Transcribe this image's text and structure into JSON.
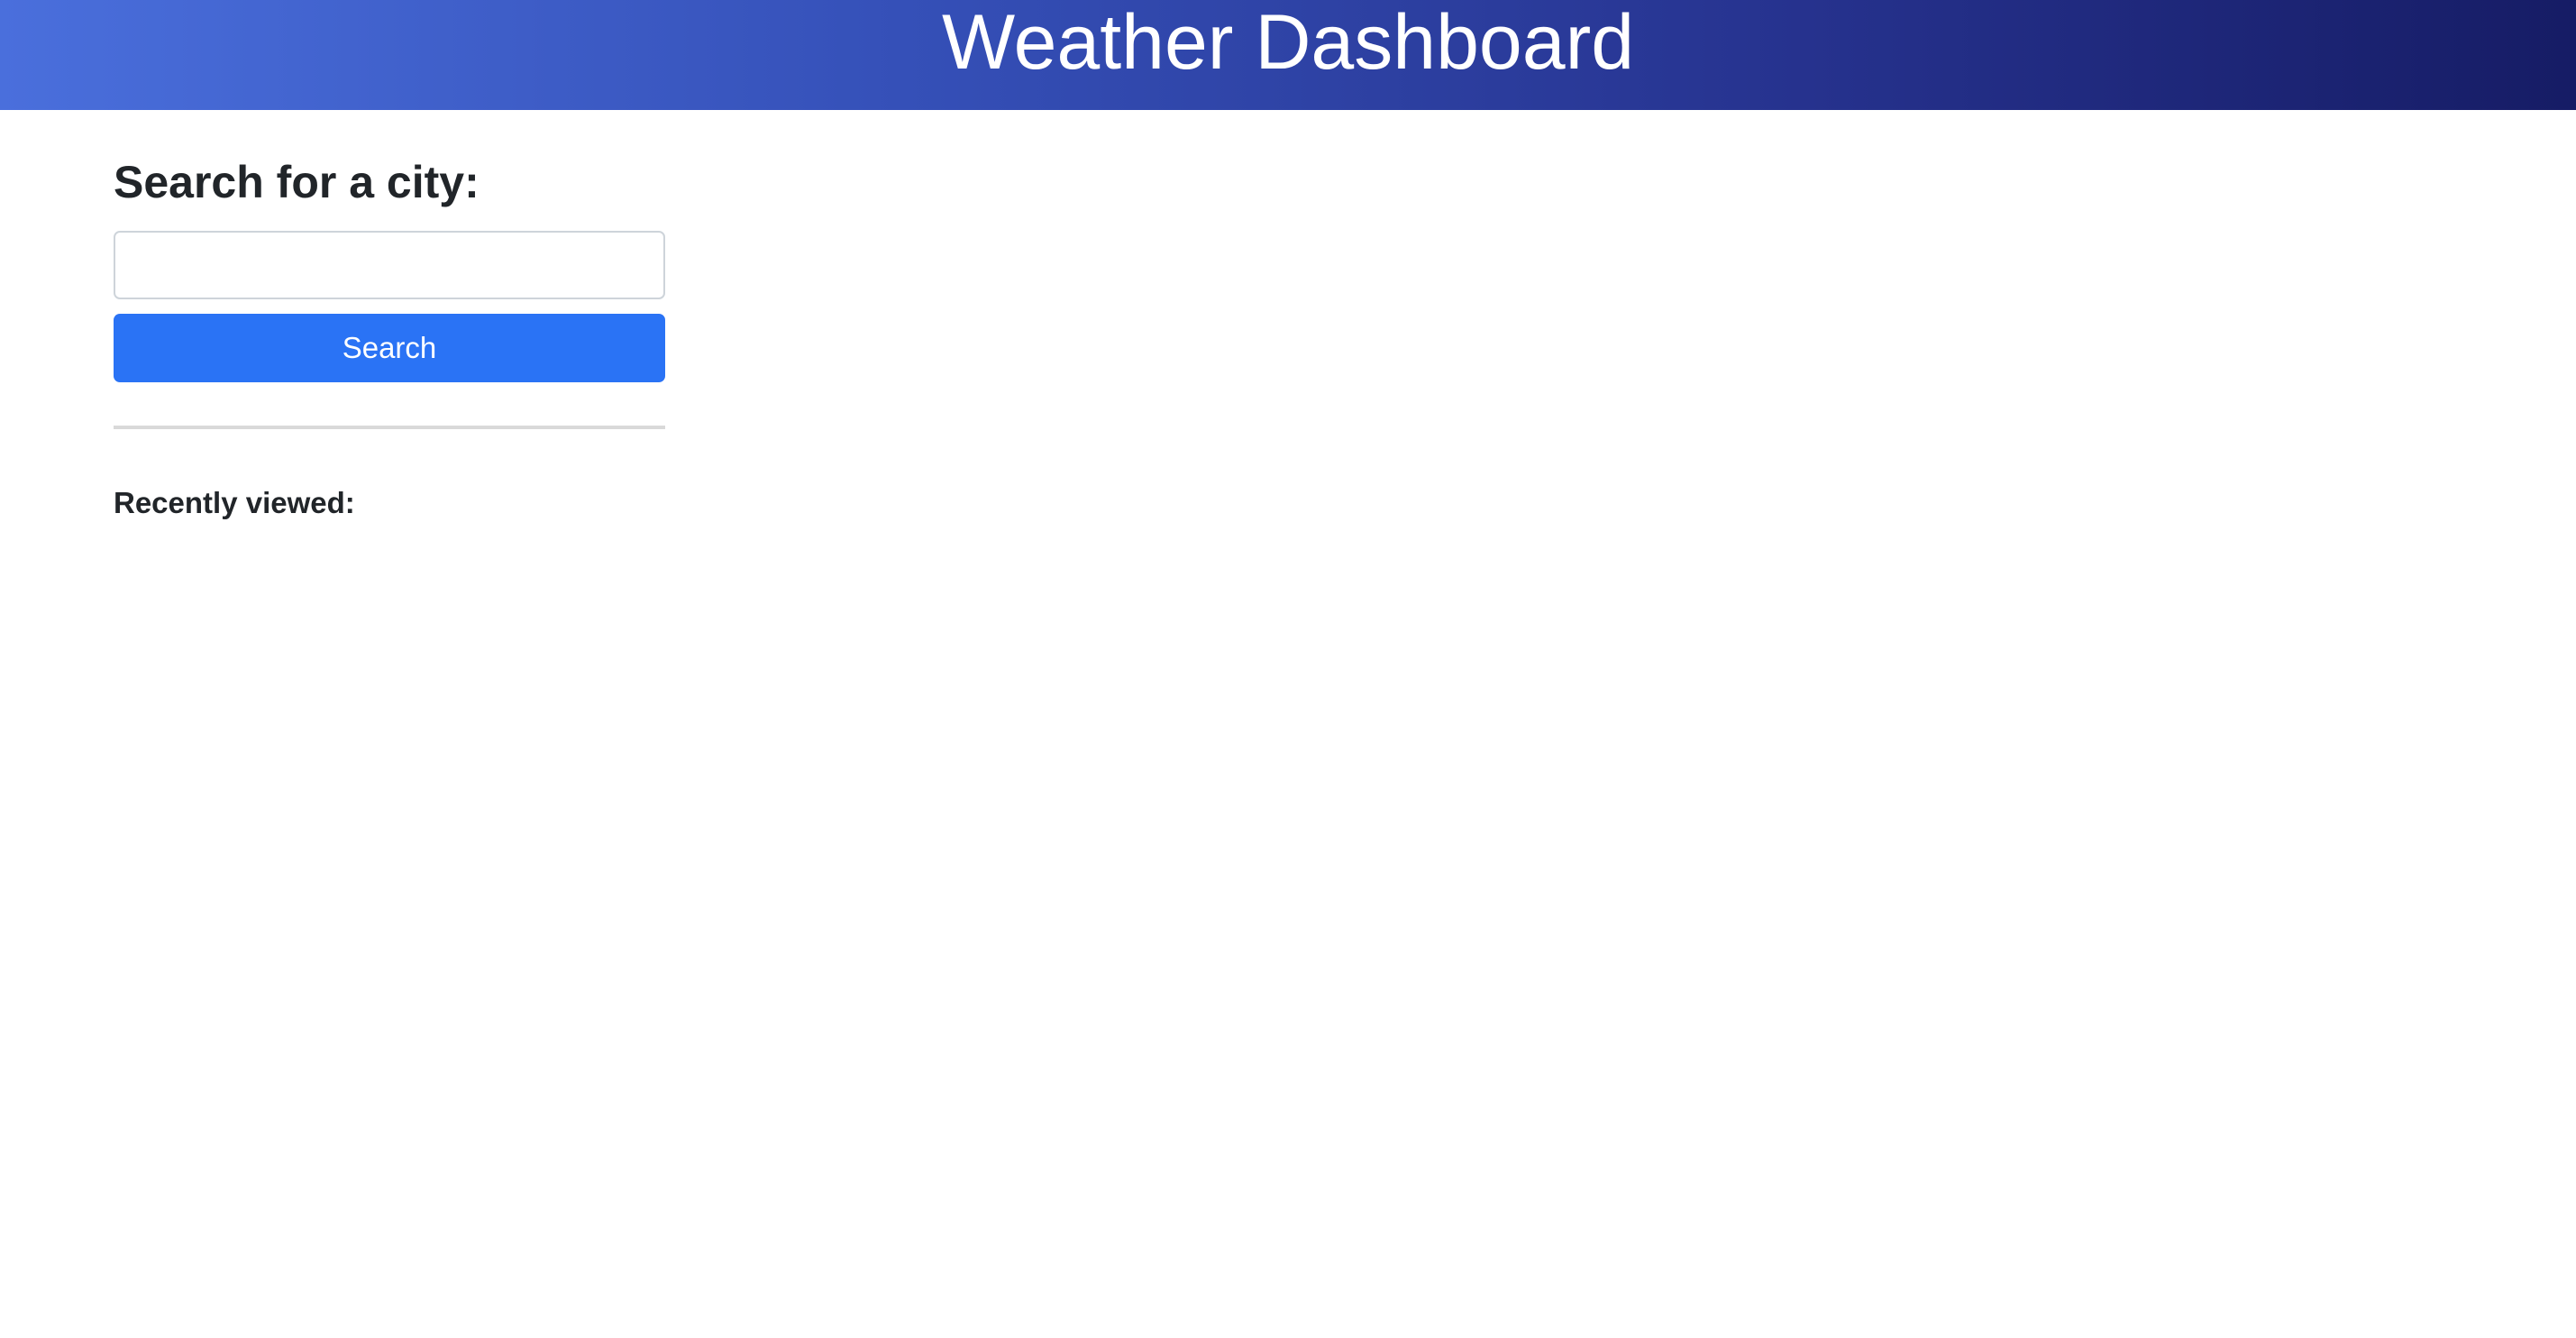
{
  "header": {
    "title": "Weather Dashboard"
  },
  "search": {
    "heading": "Search for a city:",
    "input_value": "",
    "placeholder": "",
    "button_label": "Search"
  },
  "recent": {
    "heading": "Recently viewed:",
    "items": []
  },
  "colors": {
    "header_gradient_start": "#4a6fdc",
    "header_gradient_end": "#161c65",
    "button_accent": "#2a73f5",
    "text": "#212529"
  }
}
